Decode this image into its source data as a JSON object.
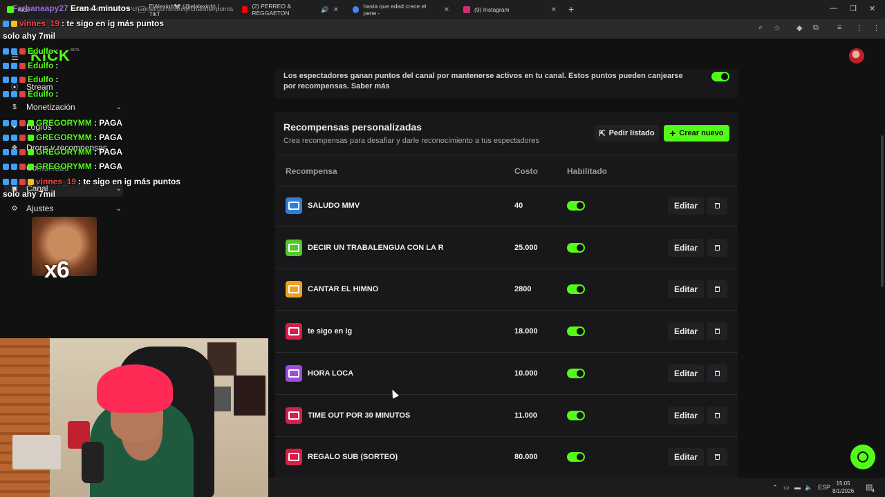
{
  "browser": {
    "tabs": [
      {
        "label": "Kick",
        "color": "#53fc18"
      },
      {
        "label": "ElAlexioh🐭 (@elalexioh) | TikT",
        "color": "#222"
      },
      {
        "label": "(2) PERREO & REGGAETON",
        "color": "#ff0000"
      },
      {
        "label": "hasta que edad crece el pene -",
        "color": "#4285f4"
      },
      {
        "label": "(9) Instagram",
        "color": "#d62976"
      }
    ],
    "url": "dashboard.kick.com/channel/community/channel-points"
  },
  "overlay": {
    "top_user": "Farhanaapy27",
    "top_message": "Eran 4 minutos",
    "chat": [
      {
        "user": "vinnes_19",
        "text": " : te sigo en ig más puntos",
        "color": "red"
      },
      {
        "user": "",
        "text": "solo ahy 7mil",
        "color": "plain"
      },
      {
        "user": "Edulfo",
        "text": " :",
        "color": "green"
      },
      {
        "user": "Edulfo",
        "text": " :",
        "color": "green"
      },
      {
        "user": "Edulfo",
        "text": " :",
        "color": "green"
      },
      {
        "user": "Edulfo",
        "text": " :",
        "color": "green"
      },
      {
        "user": "GREGORYMM",
        "text": " : PAGA",
        "color": "green"
      },
      {
        "user": "GREGORYMM",
        "text": " : PAGA",
        "color": "green"
      },
      {
        "user": "GREGORYMM",
        "text": " : PAGA",
        "color": "green"
      },
      {
        "user": "GREGORYMM",
        "text": " : PAGA",
        "color": "green"
      },
      {
        "user": "vinnes_19",
        "text": " : te sigo en ig más puntos",
        "color": "red"
      },
      {
        "user": "",
        "text": "solo ahy 7mil",
        "color": "plain"
      }
    ],
    "emote_multiplier": "x6"
  },
  "sidebar": {
    "logo": "KICK",
    "beta": "BETA",
    "items": [
      {
        "label": "Stream",
        "icon": "broadcast-icon",
        "chevron": false
      },
      {
        "label": "Monetización",
        "icon": "dollar-icon",
        "chevron": true
      },
      {
        "label": "Logros",
        "icon": "trophy-icon",
        "chevron": false
      },
      {
        "label": "Drops y recompensas",
        "icon": "gift-icon",
        "chevron": false
      },
      {
        "label": "Comunidad",
        "icon": "users-icon",
        "chevron": true
      },
      {
        "label": "Canal",
        "icon": "channel-icon",
        "chevron": true
      },
      {
        "label": "Ajustes",
        "icon": "gear-icon",
        "chevron": true
      }
    ]
  },
  "main": {
    "points_description": "Los espectadores ganan puntos del canal por mantenerse activos en tu canal. Estos puntos pueden canjearse por recompensas. Saber más",
    "rewards_title": "Recompensas personalizadas",
    "rewards_subtitle": "Crea recompensas para desafiar y darle reconocimiento a tus espectadores",
    "btn_list": "Pedir listado",
    "btn_new": "Crear nuevo",
    "columns": {
      "reward": "Recompensa",
      "cost": "Costo",
      "enabled": "Habilitado"
    },
    "edit_label": "Editar",
    "rewards": [
      {
        "name": "SALUDO MMV",
        "cost": "40",
        "color": "#2f7fd8",
        "enabled": true
      },
      {
        "name": "DECIR UN TRABALENGUA CON LA R",
        "cost": "25.000",
        "color": "#53c92a",
        "enabled": true
      },
      {
        "name": "CANTAR EL HIMNO",
        "cost": "2800",
        "color": "#f0a020",
        "enabled": true
      },
      {
        "name": "te sigo en ig",
        "cost": "18.000",
        "color": "#d81e4a",
        "enabled": true
      },
      {
        "name": "HORA LOCA",
        "cost": "10.000",
        "color": "#9b4ee0",
        "enabled": true
      },
      {
        "name": "TIME OUT POR 30 MINUTOS",
        "cost": "11.000",
        "color": "#d81e4a",
        "enabled": true
      },
      {
        "name": "REGALO SUB (SORTEO)",
        "cost": "80.000",
        "color": "#d81e4a",
        "enabled": true
      }
    ]
  },
  "taskbar": {
    "lang": "ESP",
    "time": "15:05",
    "date": "8/1/2026",
    "notif_count": "4"
  }
}
